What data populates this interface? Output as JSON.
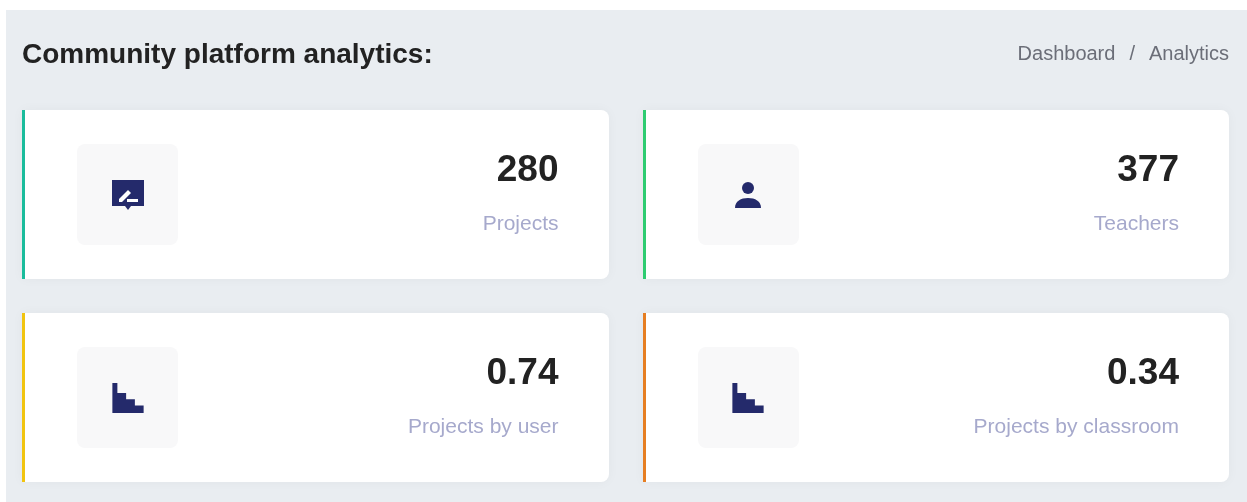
{
  "title": "Community platform analytics:",
  "breadcrumb": {
    "items": [
      "Dashboard",
      "Analytics"
    ],
    "separator": "/"
  },
  "cards": [
    {
      "value": "280",
      "label": "Projects",
      "color": "#1abc9c",
      "kind": "comment"
    },
    {
      "value": "377",
      "label": "Teachers",
      "color": "#2ecc71",
      "kind": "person"
    },
    {
      "value": "0.74",
      "label": "Projects by user",
      "color": "#f1c40f",
      "kind": "chart"
    },
    {
      "value": "0.34",
      "label": "Projects by classroom",
      "color": "#e67e22",
      "kind": "chart"
    }
  ]
}
